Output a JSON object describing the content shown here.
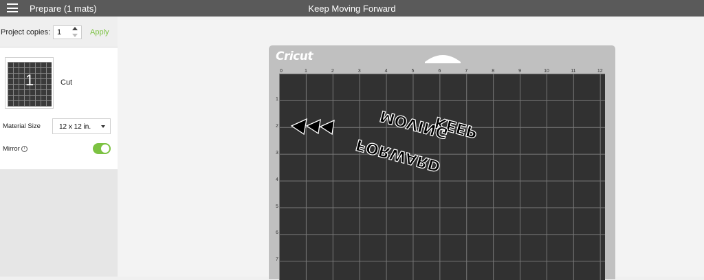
{
  "topbar": {
    "app_title": "Prepare (1 mats)",
    "project_title": "Keep Moving Forward"
  },
  "panel": {
    "copies_label": "Project copies:",
    "copies_value": "1",
    "apply_label": "Apply",
    "mat": {
      "number": "1",
      "label": "Cut"
    },
    "material_size_label": "Material Size",
    "material_size_value": "12 x 12 in.",
    "mirror_label": "Mirror",
    "mirror_on": true
  },
  "mat": {
    "brand": "Cricut",
    "ruler_x": [
      "0",
      "1",
      "2",
      "3",
      "4",
      "5",
      "6",
      "7",
      "8",
      "9",
      "10",
      "11",
      "12"
    ],
    "ruler_y": [
      "1",
      "2",
      "3",
      "4",
      "5",
      "6",
      "7"
    ],
    "design_text": [
      "KEEP",
      "MOVING",
      "FORWARD"
    ]
  },
  "colors": {
    "accent": "#7cc242",
    "topbar": "#5a5a5a",
    "mat_grid": "#313131"
  }
}
